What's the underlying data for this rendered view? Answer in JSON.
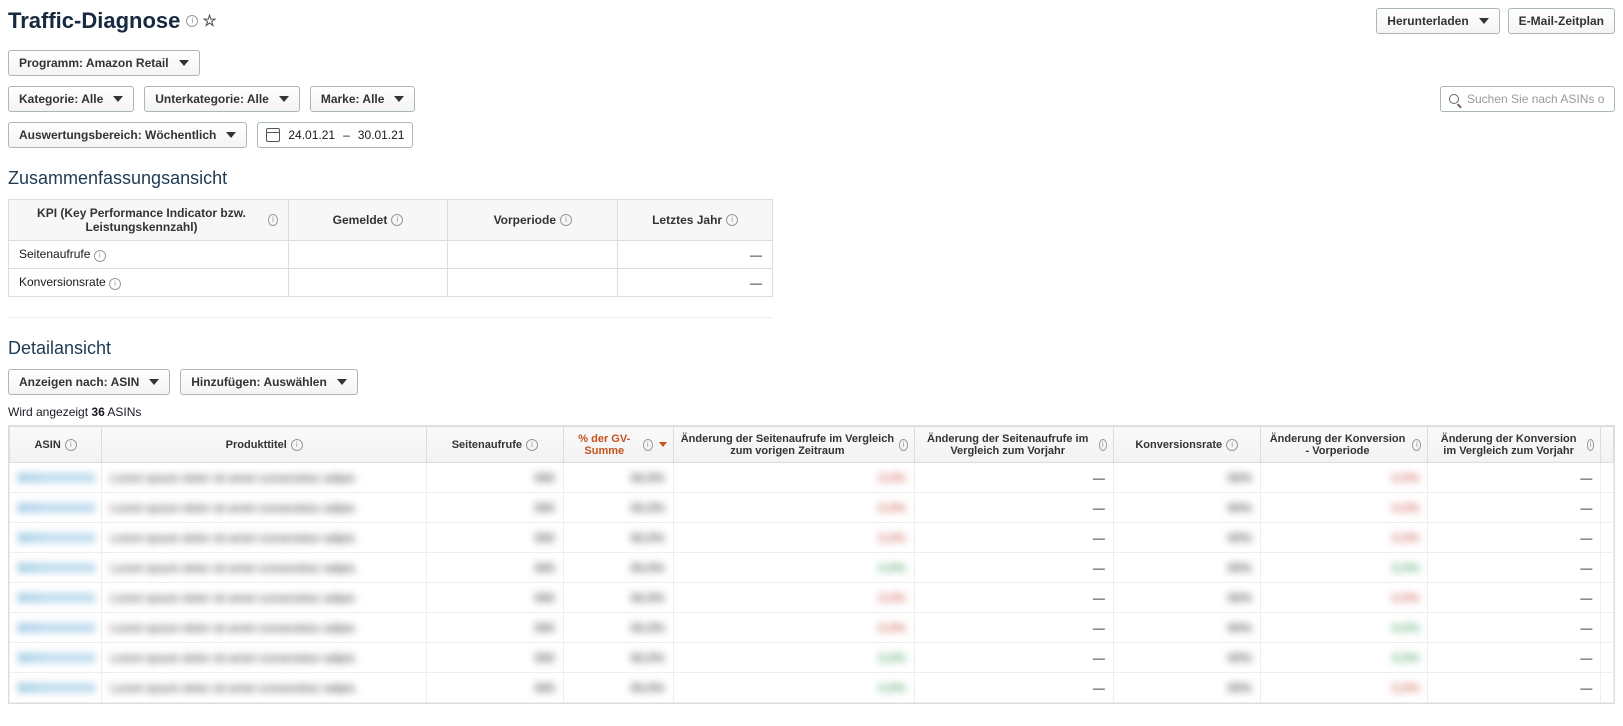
{
  "header": {
    "title": "Traffic-Diagnose",
    "download_label": "Herunterladen",
    "email_label": "E-Mail-Zeitplan"
  },
  "filters": {
    "program": "Programm: Amazon Retail",
    "category": "Kategorie: Alle",
    "subcategory": "Unterkategorie: Alle",
    "brand": "Marke: Alle",
    "reporting_range": "Auswertungsbereich: Wöchentlich",
    "date_from": "24.01.21",
    "date_to": "30.01.21",
    "search_placeholder": "Suchen Sie nach ASINs oder S"
  },
  "summary": {
    "title": "Zusammenfassungsansicht",
    "columns": {
      "kpi": "KPI (Key Performance Indicator bzw. Leistungskennzahl)",
      "reported": "Gemeldet",
      "prior": "Vorperiode",
      "last_year": "Letztes Jahr"
    },
    "rows": [
      {
        "label": "Seitenaufrufe",
        "reported": "",
        "prior": "",
        "last_year": "—"
      },
      {
        "label": "Konversionsrate",
        "reported": "",
        "prior": "",
        "last_year": "—"
      }
    ]
  },
  "detail": {
    "title": "Detailansicht",
    "show_by": "Anzeigen nach: ASIN",
    "add": "Hinzufügen: Auswählen",
    "count_prefix": "Wird angezeigt",
    "count_n": "36",
    "count_suffix": "ASINs",
    "columns": [
      "ASIN",
      "Produkttitel",
      "Seitenaufrufe",
      "% der GV-Summe",
      "Änderung der Seitenaufrufe im Vergleich zum vorigen Zeitraum",
      "Änderung der Seitenaufrufe im Vergleich zum Vorjahr",
      "Konversionsrate",
      "Änderung der Konversion - Vorperiode",
      "Änderung der Konversion im Vergleich zum Vorjahr"
    ],
    "dash": "—"
  }
}
